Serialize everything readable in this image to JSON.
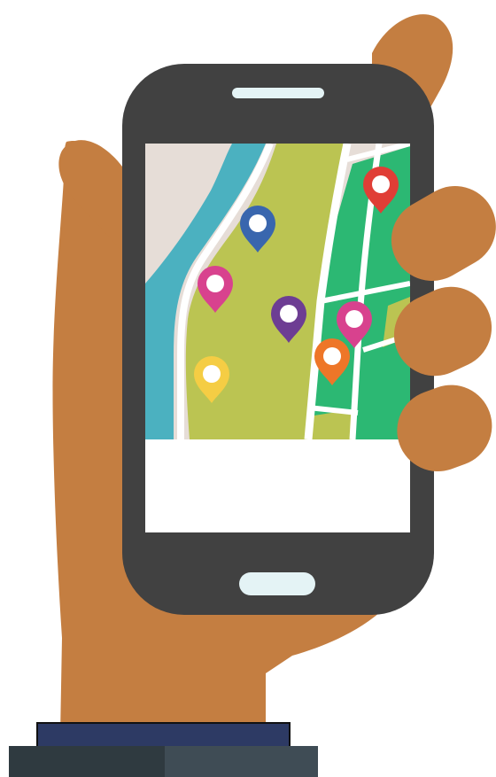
{
  "colors": {
    "skin": "#C47E41",
    "phone_body": "#414141",
    "earpiece": "#E4F3F5",
    "home_button": "#E4F3F5",
    "screen_bottom": "#FFFFFF",
    "map_land": "#E6DDD7",
    "map_river": "#4BB1C0",
    "map_park": "#BBC452",
    "map_green": "#2CB873",
    "map_road": "#FFFFFF",
    "map_road_edge": "#D9D0C9",
    "sleeve": "#2D3A64",
    "cuff_dark": "#2F3A40",
    "cuff_light": "#3F4C55"
  },
  "map_pins": [
    {
      "name": "map-pin-blue-icon",
      "color": "#3966AE"
    },
    {
      "name": "map-pin-pink-icon",
      "color": "#D8428E"
    },
    {
      "name": "map-pin-purple-icon",
      "color": "#6D3D93"
    },
    {
      "name": "map-pin-magenta-icon",
      "color": "#D8428E"
    },
    {
      "name": "map-pin-orange-icon",
      "color": "#EE7628"
    },
    {
      "name": "map-pin-yellow-icon",
      "color": "#F5CD44"
    },
    {
      "name": "map-pin-red-icon",
      "color": "#E03E36"
    }
  ]
}
